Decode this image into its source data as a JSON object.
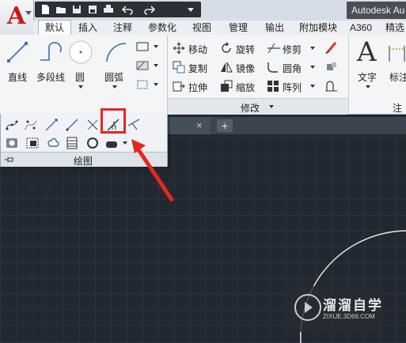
{
  "app": {
    "title": "Autodesk Au"
  },
  "quick_access": {
    "icons": [
      "new-file-icon",
      "open-folder-icon",
      "save-icon",
      "save-as-icon",
      "print-icon",
      "undo-icon",
      "redo-icon",
      "dropdown-icon"
    ]
  },
  "tabs": [
    "默认",
    "插入",
    "注释",
    "参数化",
    "视图",
    "管理",
    "输出",
    "附加模块",
    "A360",
    "精选"
  ],
  "active_tab": "默认",
  "draw_panel": {
    "buttons": [
      "直线",
      "多段线",
      "圆",
      "圆弧"
    ],
    "title": "绘图"
  },
  "modify_panel": {
    "rows": [
      [
        "移动",
        "旋转",
        "修剪"
      ],
      [
        "复制",
        "镜像",
        "圆角"
      ],
      [
        "拉伸",
        "缩放",
        "阵列"
      ]
    ],
    "title": "修改"
  },
  "annotation_panel": {
    "buttons": [
      "文字",
      "标注"
    ],
    "title": "注"
  },
  "file_tabs": {
    "close": "×",
    "add": "+"
  },
  "watermark": {
    "name": "溜溜自学",
    "url": "ZIXUE.3D66.COM"
  },
  "colors": {
    "highlight": "#e8261f",
    "canvas": "#212830",
    "logo_red": "#c8161d"
  }
}
